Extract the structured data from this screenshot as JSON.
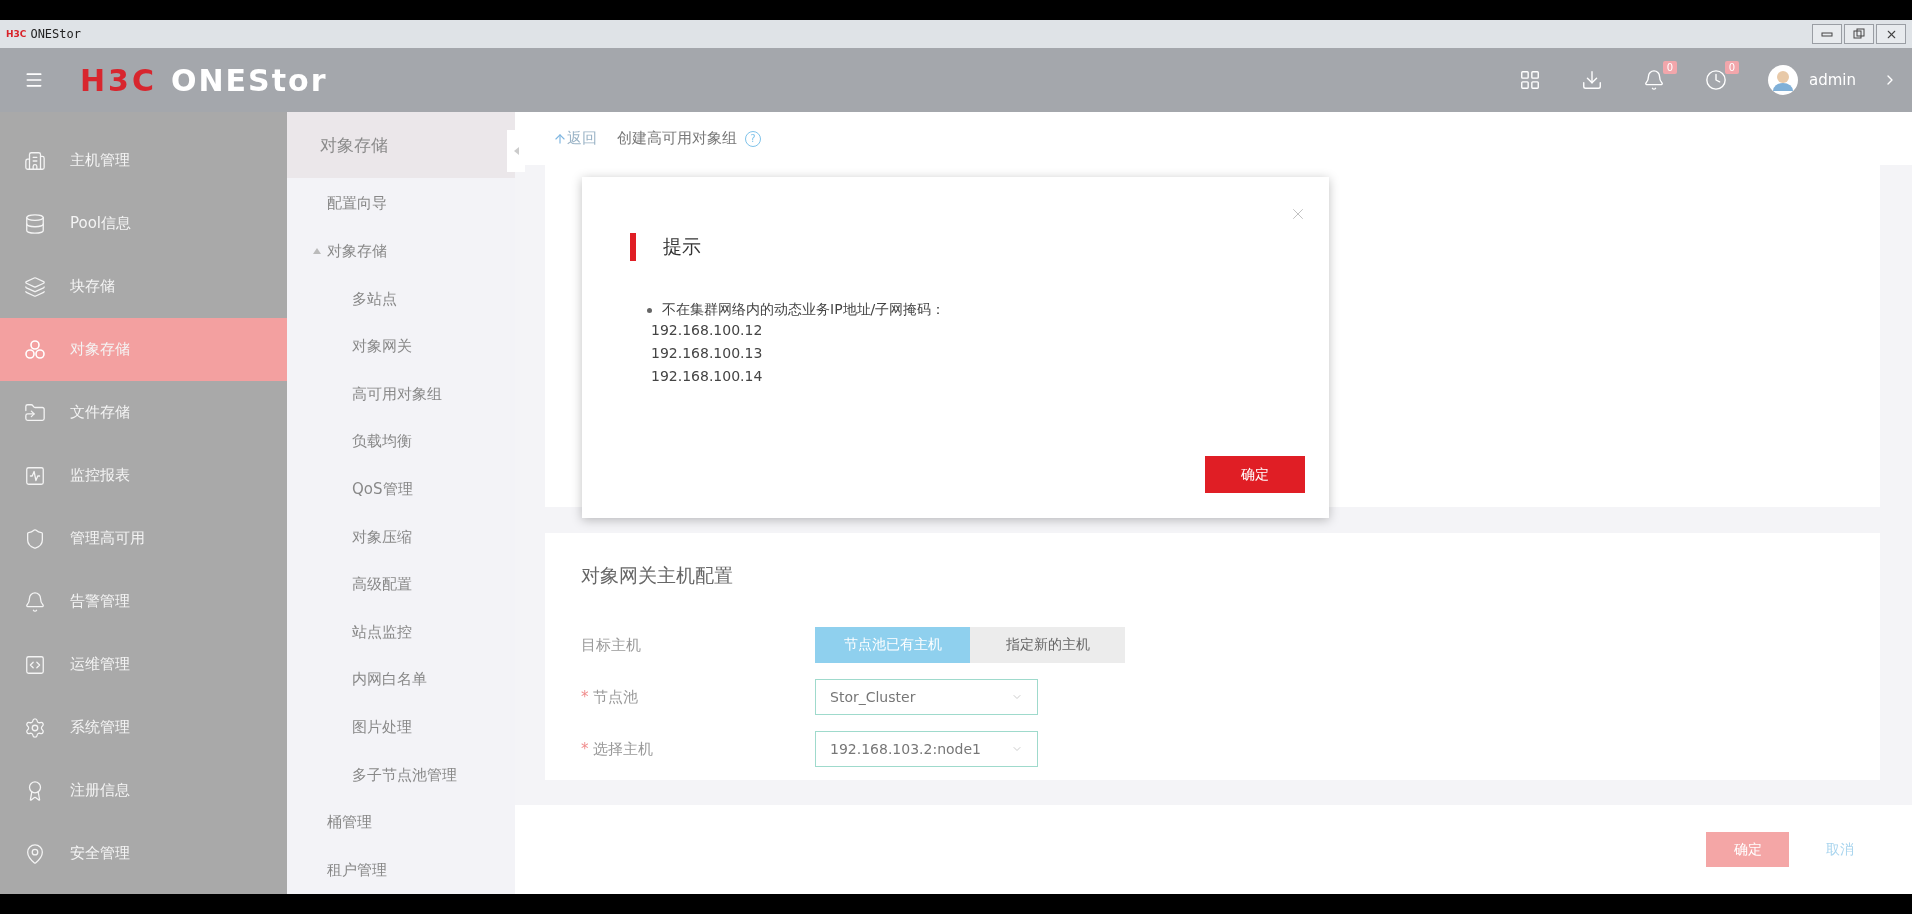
{
  "window": {
    "logo": "H3C",
    "title": "ONEStor"
  },
  "header": {
    "logo_mark": "H3C",
    "logo_text": "ONEStor",
    "notifications": [
      {
        "count": "0"
      },
      {
        "count": "0"
      }
    ],
    "user": "admin"
  },
  "sidebar": {
    "items": [
      {
        "label": "主机管理",
        "selected": false
      },
      {
        "label": "Pool信息",
        "selected": false
      },
      {
        "label": "块存储",
        "selected": false
      },
      {
        "label": "对象存储",
        "selected": true
      },
      {
        "label": "文件存储",
        "selected": false
      },
      {
        "label": "监控报表",
        "selected": false
      },
      {
        "label": "管理高可用",
        "selected": false
      },
      {
        "label": "告警管理",
        "selected": false
      },
      {
        "label": "运维管理",
        "selected": false
      },
      {
        "label": "系统管理",
        "selected": false
      },
      {
        "label": "注册信息",
        "selected": false
      },
      {
        "label": "安全管理",
        "selected": false
      }
    ]
  },
  "submenu": {
    "title": "对象存储",
    "items": [
      {
        "label": "配置向导"
      },
      {
        "label": "对象存储",
        "expanded": true,
        "children": [
          {
            "label": "多站点"
          },
          {
            "label": "对象网关"
          },
          {
            "label": "高可用对象组"
          },
          {
            "label": "负载均衡"
          },
          {
            "label": "QoS管理"
          },
          {
            "label": "对象压缩"
          },
          {
            "label": "高级配置"
          },
          {
            "label": "站点监控"
          },
          {
            "label": "内网白名单"
          },
          {
            "label": "图片处理"
          },
          {
            "label": "多子节点池管理"
          }
        ]
      },
      {
        "label": "桶管理"
      },
      {
        "label": "租户管理"
      }
    ]
  },
  "breadcrumb": {
    "back": "返回",
    "title": "创建高可用对象组",
    "help": "?"
  },
  "dialog": {
    "title": "提示",
    "message": "不在集群网络内的动态业务IP地址/子网掩码：",
    "addresses": [
      "192.168.100.12",
      "192.168.100.13",
      "192.168.100.14"
    ],
    "button": "确定"
  },
  "host_config": {
    "title": "对象网关主机配置",
    "target": {
      "label": "目标主机",
      "options": [
        {
          "label": "节点池已有主机",
          "selected": true
        },
        {
          "label": "指定新的主机",
          "selected": false
        }
      ]
    },
    "fields": [
      {
        "marker": "*",
        "label": "节点池",
        "value": "Stor_Cluster"
      },
      {
        "marker": "*",
        "label": "选择主机",
        "value": "192.168.103.2:node1"
      }
    ]
  },
  "footer": {
    "confirm": "确定",
    "cancel": "取消"
  }
}
